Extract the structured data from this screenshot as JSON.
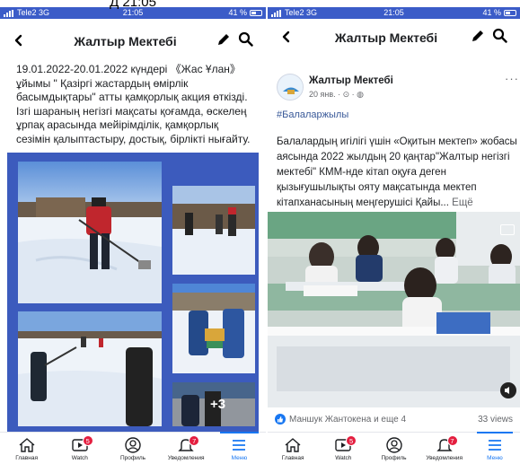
{
  "overlay_title": "Д                      21:05",
  "left": {
    "status": {
      "carrier": "Tele2 3G",
      "time": "21:05",
      "battery": "41 %"
    },
    "header": {
      "title": "Жалтыр Мектебі"
    },
    "post_text": "19.01.2022-20.01.2022 күндері 《Жас Ұлан》 ұйымы \" Қазіргі жастардың өмірлік басымдықтары\" атты қамқорлық акция өткізді. Ізгі шараның негізгі мақсаты қоғамда, өскелең ұрпақ арасында мейірімділік, қамқорлық сезімін қалыптастыру, достық, бірлікті нығайту.",
    "photos_more": "+3"
  },
  "right": {
    "status": {
      "carrier": "Tele2 3G",
      "time": "21:05",
      "battery": "41 %"
    },
    "header": {
      "title": "Жалтыр Мектебі"
    },
    "page_name": "Жалтыр Мектебі",
    "post_meta": "20 янв. · ⊙ · ◍",
    "menu_dots": "···",
    "hashtag": "#Балаларжылы",
    "post_text": "Балалардың игілігі үшін «Оқитын мектеп» жобасы аясында  2022 жылдың 20 қаңтар\"Жалтыр негізгі мектебі\" КММ-нде кітап оқуға деген қызығушылықты ояту мақсатында мектеп кітапханасының меңгерушісі Қайы...",
    "more_label": " Ещё",
    "reactions": "Маншук Жантокена и еще 4",
    "views": "33 views"
  },
  "tabs": [
    {
      "label": "Главная",
      "badge": ""
    },
    {
      "label": "Watch",
      "badge": "5"
    },
    {
      "label": "Профиль",
      "badge": ""
    },
    {
      "label": "Уведомления",
      "badge": "7"
    },
    {
      "label": "Меню",
      "badge": ""
    }
  ],
  "colors": {
    "accent": "#1877f2",
    "status_bar": "#3b5cc8",
    "photo_bg": "#3c5bbd",
    "badge": "#e41e3f"
  },
  "icons": [
    "back-arrow-icon",
    "pencil-icon",
    "search-icon",
    "home-icon",
    "watch-icon",
    "profile-icon",
    "bell-icon",
    "menu-icon",
    "mute-icon",
    "like-icon",
    "globe-icon",
    "clock-icon"
  ]
}
